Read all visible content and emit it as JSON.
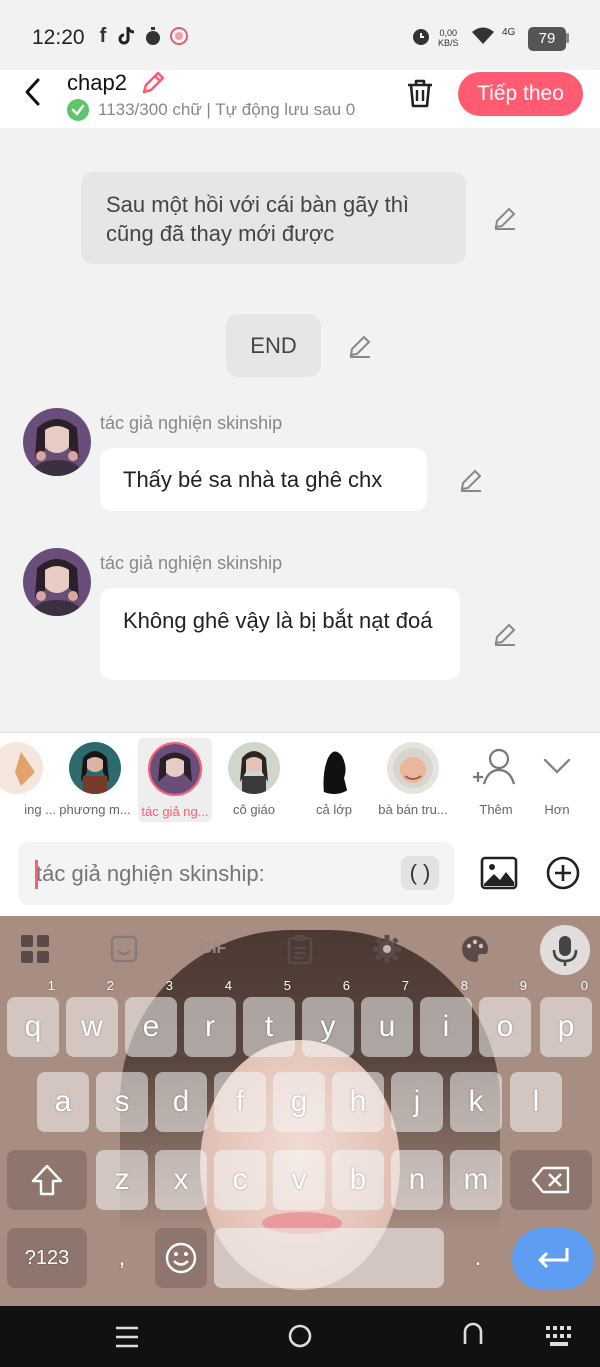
{
  "status_bar": {
    "time": "12:20",
    "net_speed_value": "0,00",
    "net_speed_unit": "KB/S",
    "network": "4G",
    "battery": "79"
  },
  "header": {
    "chapter_title": "chap2",
    "save_status": "1133/300 chữ | Tự động lưu sau 0",
    "next_button": "Tiếp theo"
  },
  "chat": {
    "narration_1": "Sau một hồi với cái bàn gãy thì cũng đã thay mới được",
    "narration_2": "END",
    "messages": [
      {
        "speaker": "tác giả nghiện skinship",
        "text": "Thấy bé sa nhà ta ghê chx"
      },
      {
        "speaker": "tác giả nghiện skinship",
        "text": "Không ghê vậy là bị bắt nạt đoá"
      }
    ]
  },
  "characters": {
    "items": [
      {
        "name": "ing ..."
      },
      {
        "name": "phương m..."
      },
      {
        "name": "tác giả ng..."
      },
      {
        "name": "cô giáo"
      },
      {
        "name": "cả lớp"
      },
      {
        "name": "bà bán tru..."
      }
    ],
    "add_label": "Thêm",
    "more_label": "Hơn"
  },
  "input": {
    "placeholder": "tác giả nghiện skinship:",
    "paren_label": "( )"
  },
  "keyboard": {
    "toolbar_gif": "GIF",
    "row1": [
      {
        "key": "q",
        "hint": "1"
      },
      {
        "key": "w",
        "hint": "2"
      },
      {
        "key": "e",
        "hint": "3"
      },
      {
        "key": "r",
        "hint": "4"
      },
      {
        "key": "t",
        "hint": "5"
      },
      {
        "key": "y",
        "hint": "6"
      },
      {
        "key": "u",
        "hint": "7"
      },
      {
        "key": "i",
        "hint": "8"
      },
      {
        "key": "o",
        "hint": "9"
      },
      {
        "key": "p",
        "hint": "0"
      }
    ],
    "row2": [
      "a",
      "s",
      "d",
      "f",
      "g",
      "h",
      "j",
      "k",
      "l"
    ],
    "row3": [
      "z",
      "x",
      "c",
      "v",
      "b",
      "n",
      "m"
    ],
    "symbols_key": "?123",
    "comma_key": ",",
    "period_key": "."
  },
  "colors": {
    "accent": "#ff5b72",
    "enter_key": "#5e9df2",
    "save_ok": "#5fc46a"
  }
}
